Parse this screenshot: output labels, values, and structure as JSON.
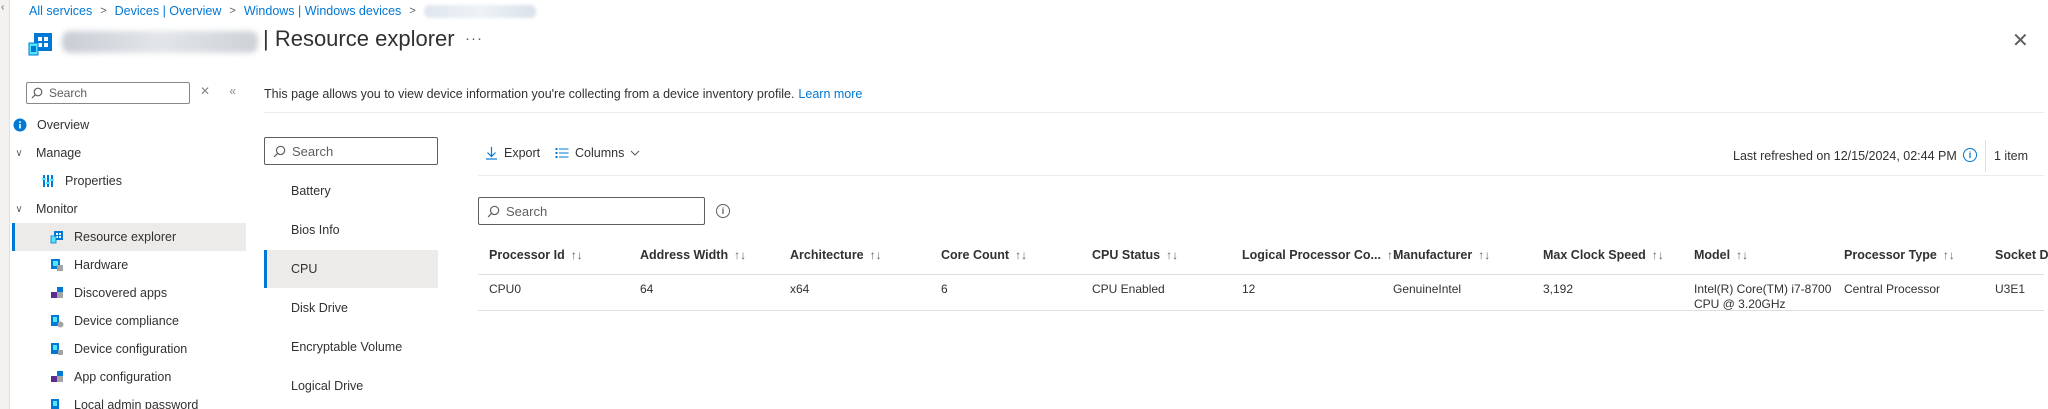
{
  "breadcrumb": {
    "items": [
      "All services",
      "Devices | Overview",
      "Windows | Windows devices"
    ],
    "separator": ">"
  },
  "header": {
    "title": "| Resource explorer",
    "more": "···",
    "close": "✕"
  },
  "nav": {
    "search_placeholder": "Search",
    "tools": {
      "clear": "✕",
      "collapse": "«"
    },
    "items": [
      {
        "label": "Overview",
        "icon": "info-circle-icon"
      },
      {
        "label": "Manage",
        "icon": "chevron-down-icon"
      },
      {
        "label": "Properties",
        "icon": "properties-icon"
      },
      {
        "label": "Monitor",
        "icon": "chevron-down-icon"
      },
      {
        "label": "Resource explorer",
        "icon": "resource-explorer-icon"
      },
      {
        "label": "Hardware",
        "icon": "hardware-icon"
      },
      {
        "label": "Discovered apps",
        "icon": "apps-icon"
      },
      {
        "label": "Device compliance",
        "icon": "compliance-icon"
      },
      {
        "label": "Device configuration",
        "icon": "configuration-icon"
      },
      {
        "label": "App configuration",
        "icon": "app-config-icon"
      },
      {
        "label": "Local admin password",
        "icon": "password-icon"
      }
    ]
  },
  "intro": {
    "text": "This page allows you to view device information you're collecting from a device inventory profile.",
    "link": "Learn more"
  },
  "categories": {
    "search_placeholder": "Search",
    "items": [
      "Battery",
      "Bios Info",
      "CPU",
      "Disk Drive",
      "Encryptable Volume",
      "Logical Drive"
    ],
    "selected": "CPU"
  },
  "toolbar": {
    "export": "Export",
    "columns": "Columns",
    "last_refreshed": "Last refreshed on 12/15/2024, 02:44 PM",
    "item_count": "1 item"
  },
  "grid": {
    "search_placeholder": "Search",
    "sort_glyph": "↑↓",
    "columns": [
      "Processor Id",
      "Address Width",
      "Architecture",
      "Core Count",
      "CPU Status",
      "Logical Processor Co...",
      "Manufacturer",
      "Max Clock Speed",
      "Model",
      "Processor Type",
      "Socket D"
    ],
    "rows": [
      [
        "CPU0",
        "64",
        "x64",
        "6",
        "CPU Enabled",
        "12",
        "GenuineIntel",
        "3,192",
        "Intel(R) Core(TM) i7-8700 CPU @ 3.20GHz",
        "Central Processor",
        "U3E1"
      ]
    ]
  },
  "colors": {
    "accent": "#0078d4",
    "text": "#323130",
    "selected_bg": "#edebe9"
  }
}
